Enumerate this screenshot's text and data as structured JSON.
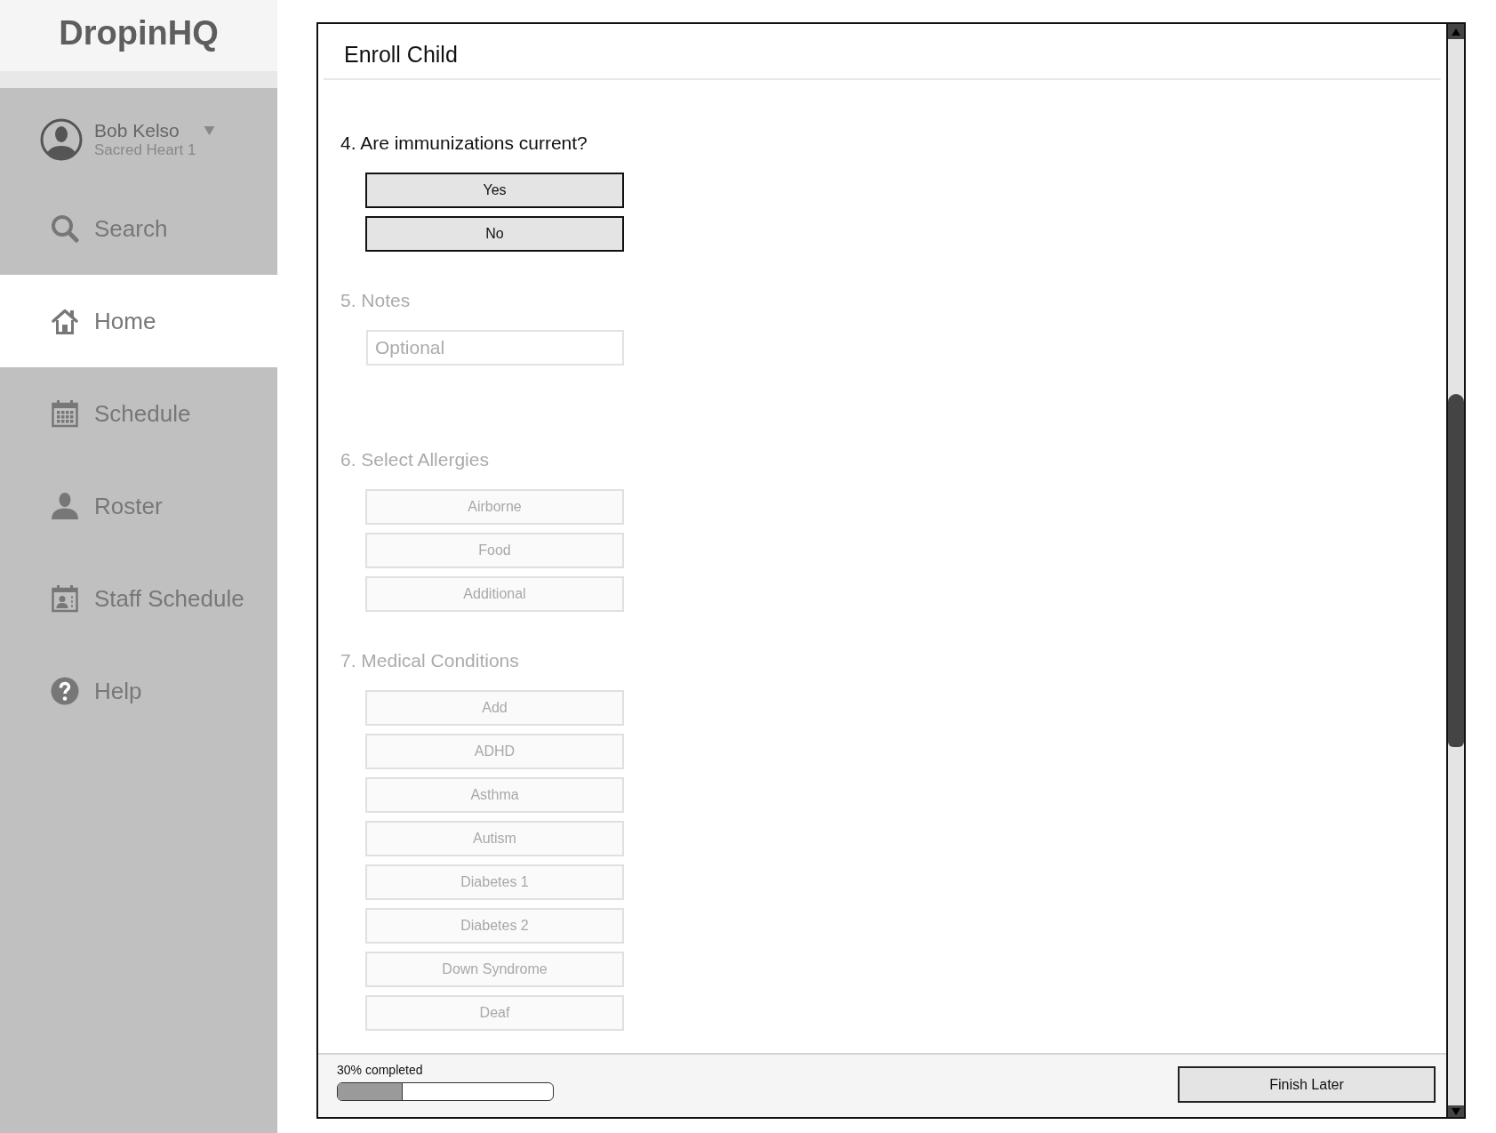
{
  "sidebar": {
    "logo": "DropinHQ",
    "user": {
      "name": "Bob Kelso",
      "location": "Sacred Heart 1"
    },
    "nav": [
      {
        "label": "Search",
        "selected": false
      },
      {
        "label": "Home",
        "selected": true
      },
      {
        "label": "Schedule",
        "selected": false
      },
      {
        "label": "Roster",
        "selected": false
      },
      {
        "label": "Staff Schedule",
        "selected": false
      },
      {
        "label": "Help",
        "selected": false
      }
    ]
  },
  "form": {
    "title": "Enroll Child",
    "questions": [
      {
        "kind": "buttons",
        "label": "4. Are immunizations current?",
        "disabled": false,
        "options": [
          {
            "label": "Yes",
            "selected": false
          },
          {
            "label": "No",
            "selected": false
          }
        ]
      },
      {
        "kind": "text",
        "label": "5. Notes",
        "disabled": true,
        "placeholder": "Optional"
      },
      {
        "kind": "buttons",
        "label": "6. Select Allergies",
        "disabled": true,
        "options": [
          {
            "label": "Airborne",
            "selected": false
          },
          {
            "label": "Food",
            "selected": false
          },
          {
            "label": "Additional",
            "selected": false
          }
        ]
      },
      {
        "kind": "buttons",
        "label": "7. Medical Conditions",
        "disabled": true,
        "options": [
          {
            "label": "Add",
            "selected": false
          },
          {
            "label": "ADHD",
            "selected": false
          },
          {
            "label": "Asthma",
            "selected": false
          },
          {
            "label": "Autism",
            "selected": false
          },
          {
            "label": "Diabetes 1",
            "selected": false
          },
          {
            "label": "Diabetes 2",
            "selected": false
          },
          {
            "label": "Down Syndrome",
            "selected": false
          },
          {
            "label": "Deaf",
            "selected": false
          }
        ]
      }
    ],
    "footer": {
      "progress_label": "30% completed",
      "level": 0.3,
      "button": "Finish Later"
    }
  }
}
